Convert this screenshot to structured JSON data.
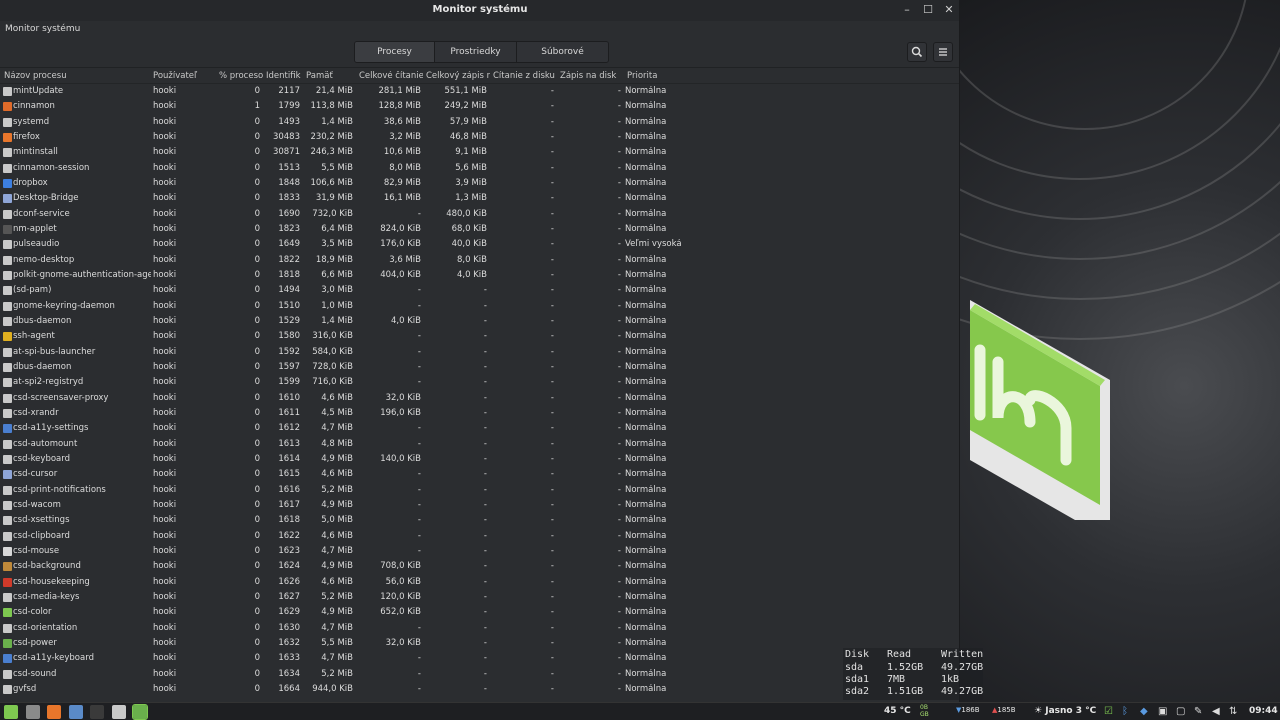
{
  "window": {
    "title": "Monitor systému",
    "menu_label": "Monitor systému",
    "minimize_glyph": "–",
    "maximize_glyph": "☐",
    "close_glyph": "✕"
  },
  "tabs": [
    {
      "label": "Procesy",
      "active": true
    },
    {
      "label": "Prostriedky",
      "active": false
    },
    {
      "label": "Súborové systémy",
      "active": false
    }
  ],
  "toolbar_icons": [
    "search-icon",
    "hamburger-menu-icon"
  ],
  "columns": [
    "Názov procesu",
    "Používateľ",
    "% procesor",
    "Identifik",
    "Pamäť",
    "Celkové čítanie",
    "Celkový zápis n",
    "Čítanie z disku",
    "Zápis na disk",
    "Priorita"
  ],
  "processes": [
    {
      "name": "mintUpdate",
      "user": "hooki",
      "cpu": "0",
      "pid": "2117",
      "mem": "21,4 MiB",
      "read": "281,1 MiB",
      "write": "551,1 MiB",
      "dread": "-",
      "dwrite": "-",
      "prio": "Normálna",
      "icon": "#c9c9c9"
    },
    {
      "name": "cinnamon",
      "user": "hooki",
      "cpu": "1",
      "pid": "1799",
      "mem": "113,8 MiB",
      "read": "128,8 MiB",
      "write": "249,2 MiB",
      "dread": "-",
      "dwrite": "-",
      "prio": "Normálna",
      "icon": "#e06b2a"
    },
    {
      "name": "systemd",
      "user": "hooki",
      "cpu": "0",
      "pid": "1493",
      "mem": "1,4 MiB",
      "read": "38,6 MiB",
      "write": "57,9 MiB",
      "dread": "-",
      "dwrite": "-",
      "prio": "Normálna",
      "icon": "#c9c9c9"
    },
    {
      "name": "firefox",
      "user": "hooki",
      "cpu": "0",
      "pid": "30483",
      "mem": "230,2 MiB",
      "read": "3,2 MiB",
      "write": "46,8 MiB",
      "dread": "-",
      "dwrite": "-",
      "prio": "Normálna",
      "icon": "#e8762b"
    },
    {
      "name": "mintinstall",
      "user": "hooki",
      "cpu": "0",
      "pid": "30871",
      "mem": "246,3 MiB",
      "read": "10,6 MiB",
      "write": "9,1 MiB",
      "dread": "-",
      "dwrite": "-",
      "prio": "Normálna",
      "icon": "#c9c9c9"
    },
    {
      "name": "cinnamon-session",
      "user": "hooki",
      "cpu": "0",
      "pid": "1513",
      "mem": "5,5 MiB",
      "read": "8,0 MiB",
      "write": "5,6 MiB",
      "dread": "-",
      "dwrite": "-",
      "prio": "Normálna",
      "icon": "#c9c9c9"
    },
    {
      "name": "dropbox",
      "user": "hooki",
      "cpu": "0",
      "pid": "1848",
      "mem": "106,6 MiB",
      "read": "82,9 MiB",
      "write": "3,9 MiB",
      "dread": "-",
      "dwrite": "-",
      "prio": "Normálna",
      "icon": "#3d7fe0"
    },
    {
      "name": "Desktop-Bridge",
      "user": "hooki",
      "cpu": "0",
      "pid": "1833",
      "mem": "31,9 MiB",
      "read": "16,1 MiB",
      "write": "1,3 MiB",
      "dread": "-",
      "dwrite": "-",
      "prio": "Normálna",
      "icon": "#8fa6d8"
    },
    {
      "name": "dconf-service",
      "user": "hooki",
      "cpu": "0",
      "pid": "1690",
      "mem": "732,0 KiB",
      "read": "-",
      "write": "480,0 KiB",
      "dread": "-",
      "dwrite": "-",
      "prio": "Normálna",
      "icon": "#c9c9c9"
    },
    {
      "name": "nm-applet",
      "user": "hooki",
      "cpu": "0",
      "pid": "1823",
      "mem": "6,4 MiB",
      "read": "824,0 KiB",
      "write": "68,0 KiB",
      "dread": "-",
      "dwrite": "-",
      "prio": "Normálna",
      "icon": "#555555"
    },
    {
      "name": "pulseaudio",
      "user": "hooki",
      "cpu": "0",
      "pid": "1649",
      "mem": "3,5 MiB",
      "read": "176,0 KiB",
      "write": "40,0 KiB",
      "dread": "-",
      "dwrite": "-",
      "prio": "Veľmi vysoká",
      "icon": "#c9c9c9"
    },
    {
      "name": "nemo-desktop",
      "user": "hooki",
      "cpu": "0",
      "pid": "1822",
      "mem": "18,9 MiB",
      "read": "3,6 MiB",
      "write": "8,0 KiB",
      "dread": "-",
      "dwrite": "-",
      "prio": "Normálna",
      "icon": "#c9c9c9"
    },
    {
      "name": "polkit-gnome-authentication-agent-1",
      "user": "hooki",
      "cpu": "0",
      "pid": "1818",
      "mem": "6,6 MiB",
      "read": "404,0 KiB",
      "write": "4,0 KiB",
      "dread": "-",
      "dwrite": "-",
      "prio": "Normálna",
      "icon": "#c9c9c9"
    },
    {
      "name": "(sd-pam)",
      "user": "hooki",
      "cpu": "0",
      "pid": "1494",
      "mem": "3,0 MiB",
      "read": "-",
      "write": "-",
      "dread": "-",
      "dwrite": "-",
      "prio": "Normálna",
      "icon": "#c9c9c9"
    },
    {
      "name": "gnome-keyring-daemon",
      "user": "hooki",
      "cpu": "0",
      "pid": "1510",
      "mem": "1,0 MiB",
      "read": "-",
      "write": "-",
      "dread": "-",
      "dwrite": "-",
      "prio": "Normálna",
      "icon": "#c9c9c9"
    },
    {
      "name": "dbus-daemon",
      "user": "hooki",
      "cpu": "0",
      "pid": "1529",
      "mem": "1,4 MiB",
      "read": "4,0 KiB",
      "write": "-",
      "dread": "-",
      "dwrite": "-",
      "prio": "Normálna",
      "icon": "#c9c9c9"
    },
    {
      "name": "ssh-agent",
      "user": "hooki",
      "cpu": "0",
      "pid": "1580",
      "mem": "316,0 KiB",
      "read": "-",
      "write": "-",
      "dread": "-",
      "dwrite": "-",
      "prio": "Normálna",
      "icon": "#e0b020"
    },
    {
      "name": "at-spi-bus-launcher",
      "user": "hooki",
      "cpu": "0",
      "pid": "1592",
      "mem": "584,0 KiB",
      "read": "-",
      "write": "-",
      "dread": "-",
      "dwrite": "-",
      "prio": "Normálna",
      "icon": "#c9c9c9"
    },
    {
      "name": "dbus-daemon",
      "user": "hooki",
      "cpu": "0",
      "pid": "1597",
      "mem": "728,0 KiB",
      "read": "-",
      "write": "-",
      "dread": "-",
      "dwrite": "-",
      "prio": "Normálna",
      "icon": "#c9c9c9"
    },
    {
      "name": "at-spi2-registryd",
      "user": "hooki",
      "cpu": "0",
      "pid": "1599",
      "mem": "716,0 KiB",
      "read": "-",
      "write": "-",
      "dread": "-",
      "dwrite": "-",
      "prio": "Normálna",
      "icon": "#c9c9c9"
    },
    {
      "name": "csd-screensaver-proxy",
      "user": "hooki",
      "cpu": "0",
      "pid": "1610",
      "mem": "4,6 MiB",
      "read": "32,0 KiB",
      "write": "-",
      "dread": "-",
      "dwrite": "-",
      "prio": "Normálna",
      "icon": "#c9c9c9"
    },
    {
      "name": "csd-xrandr",
      "user": "hooki",
      "cpu": "0",
      "pid": "1611",
      "mem": "4,5 MiB",
      "read": "196,0 KiB",
      "write": "-",
      "dread": "-",
      "dwrite": "-",
      "prio": "Normálna",
      "icon": "#c9c9c9"
    },
    {
      "name": "csd-a11y-settings",
      "user": "hooki",
      "cpu": "0",
      "pid": "1612",
      "mem": "4,7 MiB",
      "read": "-",
      "write": "-",
      "dread": "-",
      "dwrite": "-",
      "prio": "Normálna",
      "icon": "#4a7fd0"
    },
    {
      "name": "csd-automount",
      "user": "hooki",
      "cpu": "0",
      "pid": "1613",
      "mem": "4,8 MiB",
      "read": "-",
      "write": "-",
      "dread": "-",
      "dwrite": "-",
      "prio": "Normálna",
      "icon": "#c9c9c9"
    },
    {
      "name": "csd-keyboard",
      "user": "hooki",
      "cpu": "0",
      "pid": "1614",
      "mem": "4,9 MiB",
      "read": "140,0 KiB",
      "write": "-",
      "dread": "-",
      "dwrite": "-",
      "prio": "Normálna",
      "icon": "#c9c9c9"
    },
    {
      "name": "csd-cursor",
      "user": "hooki",
      "cpu": "0",
      "pid": "1615",
      "mem": "4,6 MiB",
      "read": "-",
      "write": "-",
      "dread": "-",
      "dwrite": "-",
      "prio": "Normálna",
      "icon": "#8fa6d8"
    },
    {
      "name": "csd-print-notifications",
      "user": "hooki",
      "cpu": "0",
      "pid": "1616",
      "mem": "5,2 MiB",
      "read": "-",
      "write": "-",
      "dread": "-",
      "dwrite": "-",
      "prio": "Normálna",
      "icon": "#c9c9c9"
    },
    {
      "name": "csd-wacom",
      "user": "hooki",
      "cpu": "0",
      "pid": "1617",
      "mem": "4,9 MiB",
      "read": "-",
      "write": "-",
      "dread": "-",
      "dwrite": "-",
      "prio": "Normálna",
      "icon": "#c9c9c9"
    },
    {
      "name": "csd-xsettings",
      "user": "hooki",
      "cpu": "0",
      "pid": "1618",
      "mem": "5,0 MiB",
      "read": "-",
      "write": "-",
      "dread": "-",
      "dwrite": "-",
      "prio": "Normálna",
      "icon": "#c9c9c9"
    },
    {
      "name": "csd-clipboard",
      "user": "hooki",
      "cpu": "0",
      "pid": "1622",
      "mem": "4,6 MiB",
      "read": "-",
      "write": "-",
      "dread": "-",
      "dwrite": "-",
      "prio": "Normálna",
      "icon": "#c9c9c9"
    },
    {
      "name": "csd-mouse",
      "user": "hooki",
      "cpu": "0",
      "pid": "1623",
      "mem": "4,7 MiB",
      "read": "-",
      "write": "-",
      "dread": "-",
      "dwrite": "-",
      "prio": "Normálna",
      "icon": "#d8d8d8"
    },
    {
      "name": "csd-background",
      "user": "hooki",
      "cpu": "0",
      "pid": "1624",
      "mem": "4,9 MiB",
      "read": "708,0 KiB",
      "write": "-",
      "dread": "-",
      "dwrite": "-",
      "prio": "Normálna",
      "icon": "#c08a3a"
    },
    {
      "name": "csd-housekeeping",
      "user": "hooki",
      "cpu": "0",
      "pid": "1626",
      "mem": "4,6 MiB",
      "read": "56,0 KiB",
      "write": "-",
      "dread": "-",
      "dwrite": "-",
      "prio": "Normálna",
      "icon": "#d03a2a"
    },
    {
      "name": "csd-media-keys",
      "user": "hooki",
      "cpu": "0",
      "pid": "1627",
      "mem": "5,2 MiB",
      "read": "120,0 KiB",
      "write": "-",
      "dread": "-",
      "dwrite": "-",
      "prio": "Normálna",
      "icon": "#c9c9c9"
    },
    {
      "name": "csd-color",
      "user": "hooki",
      "cpu": "0",
      "pid": "1629",
      "mem": "4,9 MiB",
      "read": "652,0 KiB",
      "write": "-",
      "dread": "-",
      "dwrite": "-",
      "prio": "Normálna",
      "icon": "#7ec850"
    },
    {
      "name": "csd-orientation",
      "user": "hooki",
      "cpu": "0",
      "pid": "1630",
      "mem": "4,7 MiB",
      "read": "-",
      "write": "-",
      "dread": "-",
      "dwrite": "-",
      "prio": "Normálna",
      "icon": "#c9c9c9"
    },
    {
      "name": "csd-power",
      "user": "hooki",
      "cpu": "0",
      "pid": "1632",
      "mem": "5,5 MiB",
      "read": "32,0 KiB",
      "write": "-",
      "dread": "-",
      "dwrite": "-",
      "prio": "Normálna",
      "icon": "#6ab04c"
    },
    {
      "name": "csd-a11y-keyboard",
      "user": "hooki",
      "cpu": "0",
      "pid": "1633",
      "mem": "4,7 MiB",
      "read": "-",
      "write": "-",
      "dread": "-",
      "dwrite": "-",
      "prio": "Normálna",
      "icon": "#4a7fd0"
    },
    {
      "name": "csd-sound",
      "user": "hooki",
      "cpu": "0",
      "pid": "1634",
      "mem": "5,2 MiB",
      "read": "-",
      "write": "-",
      "dread": "-",
      "dwrite": "-",
      "prio": "Normálna",
      "icon": "#c9c9c9"
    },
    {
      "name": "gvfsd",
      "user": "hooki",
      "cpu": "0",
      "pid": "1664",
      "mem": "944,0 KiB",
      "read": "-",
      "write": "-",
      "dread": "-",
      "dwrite": "-",
      "prio": "Normálna",
      "icon": "#c9c9c9"
    }
  ],
  "conky": {
    "headers": [
      "Disk",
      "Read",
      "Written"
    ],
    "rows": [
      [
        "sda",
        "1.52GB",
        "49.27GB"
      ],
      [
        "sda1",
        "7MB",
        "1kB"
      ],
      [
        "sda2",
        "1.51GB",
        "49.27GB"
      ]
    ]
  },
  "taskbar": {
    "launchers": [
      {
        "name": "menu-icon",
        "color": "#7ec850"
      },
      {
        "name": "show-desktop-icon",
        "color": "#8a8a8a"
      },
      {
        "name": "firefox-icon",
        "color": "#e8762b"
      },
      {
        "name": "settings-icon",
        "color": "#5a8ac8"
      },
      {
        "name": "terminal-icon",
        "color": "#3a3a3a"
      },
      {
        "name": "files-icon",
        "color": "#c9c9c9"
      },
      {
        "name": "system-monitor-icon",
        "color": "#6ab04c"
      }
    ],
    "temperature": "45 °C",
    "mem_label_top": "0B",
    "mem_label_bottom": "GB",
    "net_down": "186B",
    "net_up": "185B",
    "weather": "Jasno 3 °C",
    "clock": "09:44",
    "accent": "#7ec850"
  }
}
